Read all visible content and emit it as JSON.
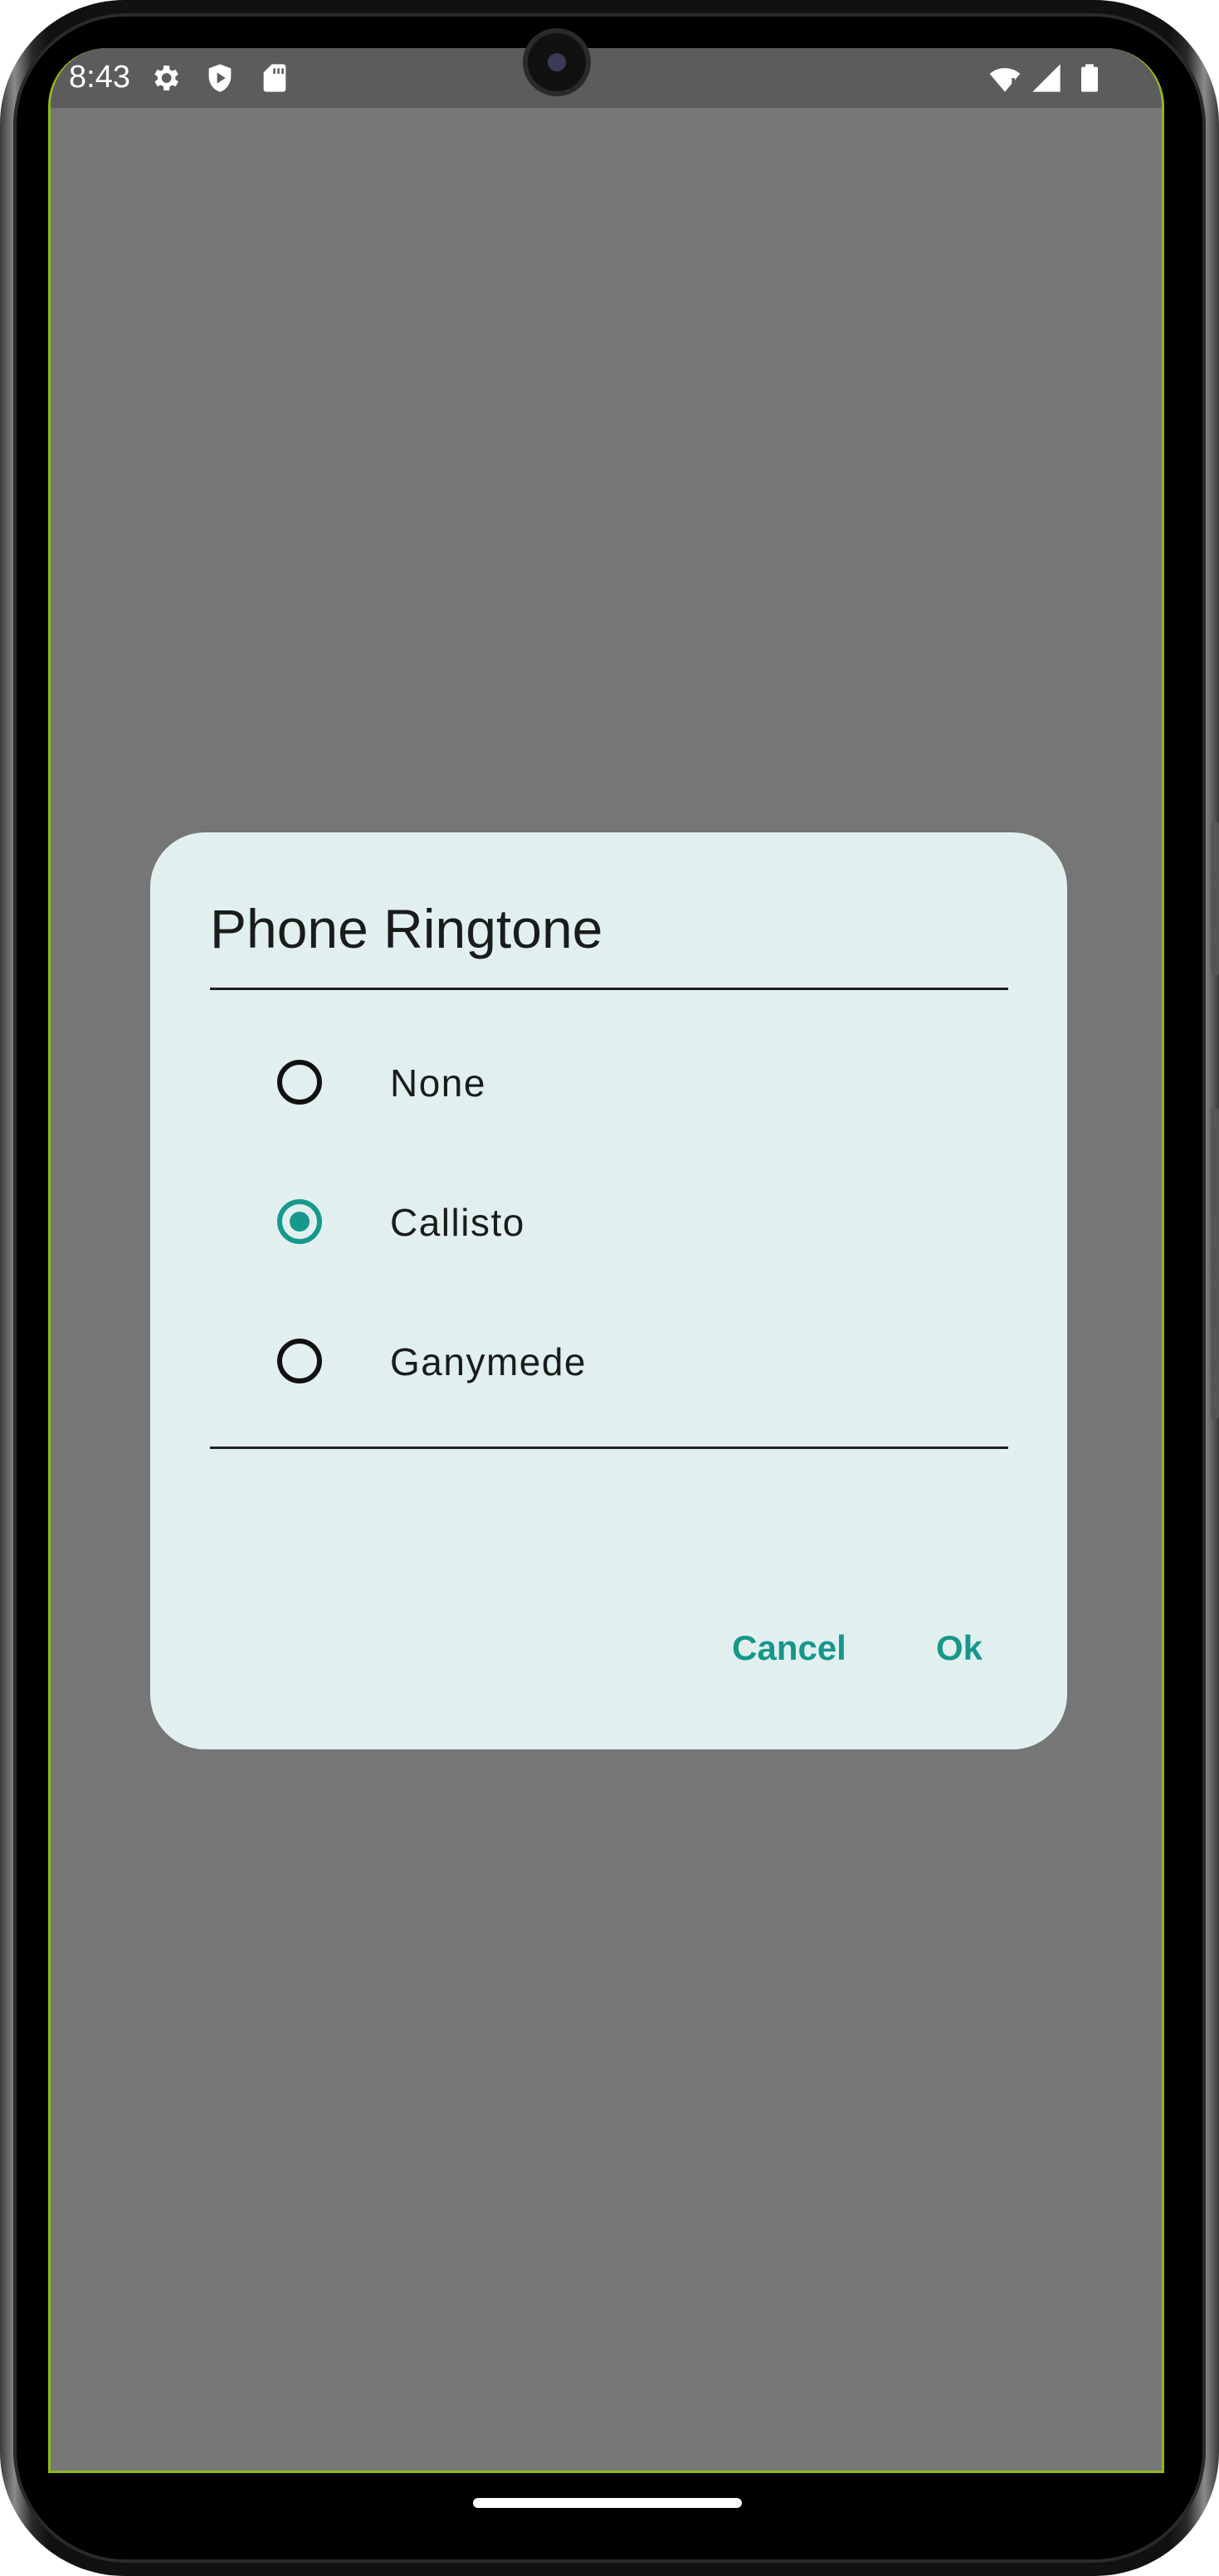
{
  "status_bar": {
    "time": "8:43",
    "left_icons": [
      "gear-icon",
      "shield-play-icon",
      "sd-card-icon"
    ],
    "right_icons": [
      "wifi-alert-icon",
      "cell-signal-icon",
      "battery-icon"
    ]
  },
  "dialog": {
    "title": "Phone Ringtone",
    "options": [
      {
        "label": "None",
        "selected": false
      },
      {
        "label": "Callisto",
        "selected": true
      },
      {
        "label": "Ganymede",
        "selected": false
      }
    ],
    "cancel_label": "Cancel",
    "ok_label": "Ok"
  },
  "colors": {
    "accent": "#17988c",
    "dialog_background": "#e1f0ef",
    "scrim": "#767676",
    "status_bar": "#5c5c5c"
  }
}
